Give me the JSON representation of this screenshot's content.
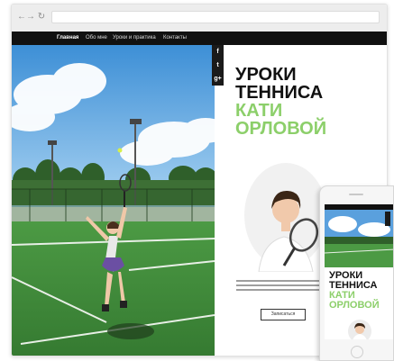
{
  "nav": {
    "items": [
      "Главная",
      "Обо мне",
      "Уроки и практика",
      "Контакты"
    ],
    "active": "Главная"
  },
  "social": {
    "facebook": "f",
    "twitter": "t",
    "googleplus": "g+"
  },
  "heading": {
    "line1": "УРОКИ",
    "line2": "ТЕННИСА",
    "line3": "КАТИ",
    "line4": "ОРЛОВОЙ"
  },
  "more_button": {
    "label": "Записаться"
  },
  "phone": {
    "heading": {
      "line1": "УРОКИ",
      "line2": "ТЕННИСА",
      "line3": "КАТИ",
      "line4": "ОРЛОВОЙ"
    }
  },
  "colors": {
    "accent": "#8ccf6a",
    "nav_bg": "#111111",
    "court_green": "#3f8a39",
    "court_line": "#e8efe6"
  },
  "icons": [
    "back-arrow-icon",
    "forward-arrow-icon",
    "reload-icon",
    "facebook-icon",
    "twitter-icon",
    "google-plus-icon"
  ]
}
